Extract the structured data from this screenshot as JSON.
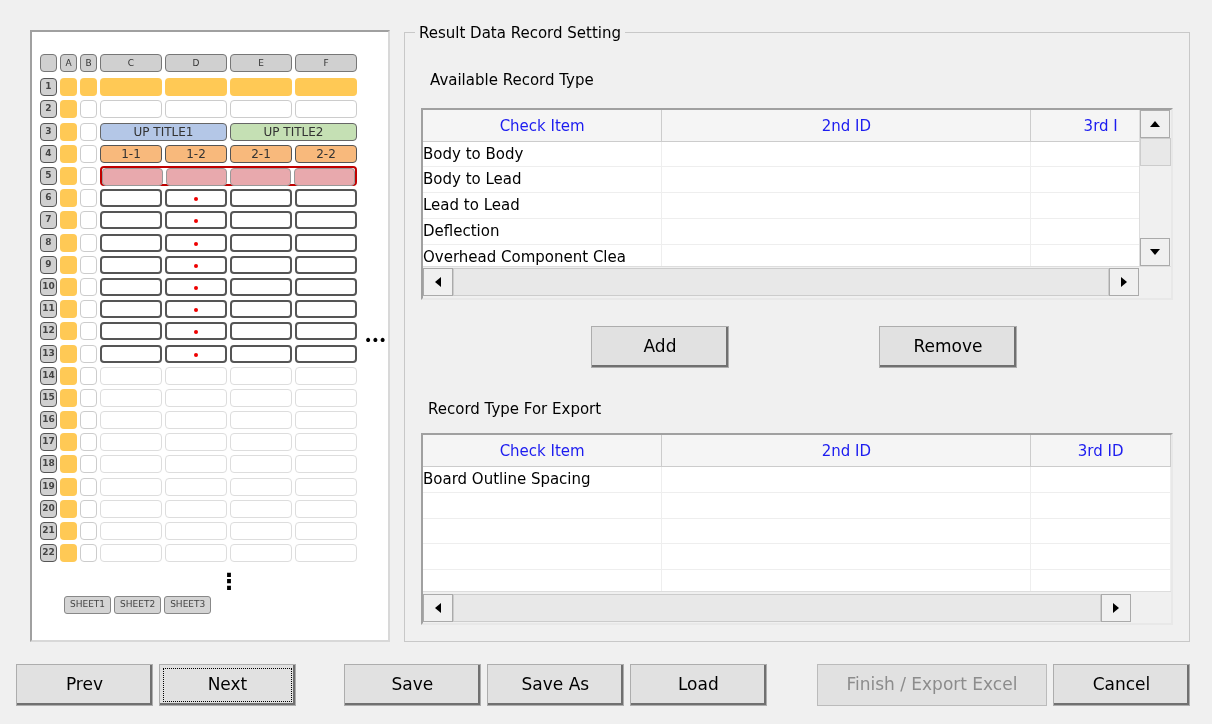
{
  "diagram": {
    "column_headers": [
      "A",
      "B",
      "C",
      "D",
      "E",
      "F"
    ],
    "rows": [
      {
        "number": "1",
        "kind": "filled"
      },
      {
        "number": "2",
        "kind": "blank"
      },
      {
        "number": "3",
        "kind": "title",
        "titles": [
          {
            "label": "UP TITLE1",
            "color": "#b4c7e7"
          },
          {
            "label": "UP TITLE2",
            "color": "#c5e0b4"
          }
        ]
      },
      {
        "number": "4",
        "kind": "subheader",
        "labels": [
          "1-1",
          "1-2",
          "2-1",
          "2-2"
        ]
      },
      {
        "number": "5",
        "kind": "highlight"
      },
      {
        "number": "6",
        "kind": "data"
      },
      {
        "number": "7",
        "kind": "data"
      },
      {
        "number": "8",
        "kind": "data"
      },
      {
        "number": "9",
        "kind": "data"
      },
      {
        "number": "10",
        "kind": "data"
      },
      {
        "number": "11",
        "kind": "data"
      },
      {
        "number": "12",
        "kind": "data"
      },
      {
        "number": "13",
        "kind": "data"
      },
      {
        "number": "14",
        "kind": "empty"
      },
      {
        "number": "15",
        "kind": "empty"
      },
      {
        "number": "16",
        "kind": "empty"
      },
      {
        "number": "17",
        "kind": "empty"
      },
      {
        "number": "18",
        "kind": "empty"
      },
      {
        "number": "19",
        "kind": "empty"
      },
      {
        "number": "20",
        "kind": "empty"
      },
      {
        "number": "21",
        "kind": "empty"
      },
      {
        "number": "22",
        "kind": "empty"
      }
    ],
    "side_ellipsis": "•••",
    "bottom_ellipsis": "⋮",
    "sheet_tabs": [
      "SHEET1",
      "SHEET2",
      "SHEET3"
    ]
  },
  "group": {
    "title": "Result Data Record Setting",
    "available": {
      "label": "Available Record Type",
      "columns": [
        "Check Item",
        "2nd ID",
        "3rd I"
      ],
      "rows": [
        "Body to Body",
        "Body to Lead",
        "Lead to Lead",
        "Deflection",
        "Overhead Component Clea"
      ]
    },
    "actions": [
      "Add",
      "Remove"
    ],
    "export": {
      "label": "Record Type For Export",
      "columns": [
        "Check Item",
        "2nd ID",
        "3rd ID"
      ],
      "rows": [
        "Board Outline Spacing"
      ]
    }
  },
  "buttons": [
    {
      "label": "Prev",
      "disabled": false,
      "focused": false
    },
    {
      "label": "Next",
      "disabled": false,
      "focused": true
    },
    {
      "label": "Save",
      "disabled": false,
      "focused": false
    },
    {
      "label": "Save As",
      "disabled": false,
      "focused": false
    },
    {
      "label": "Load",
      "disabled": false,
      "focused": false
    },
    {
      "label": "Finish / Export Excel",
      "disabled": true,
      "focused": false
    },
    {
      "label": "Cancel",
      "disabled": false,
      "focused": false
    }
  ]
}
